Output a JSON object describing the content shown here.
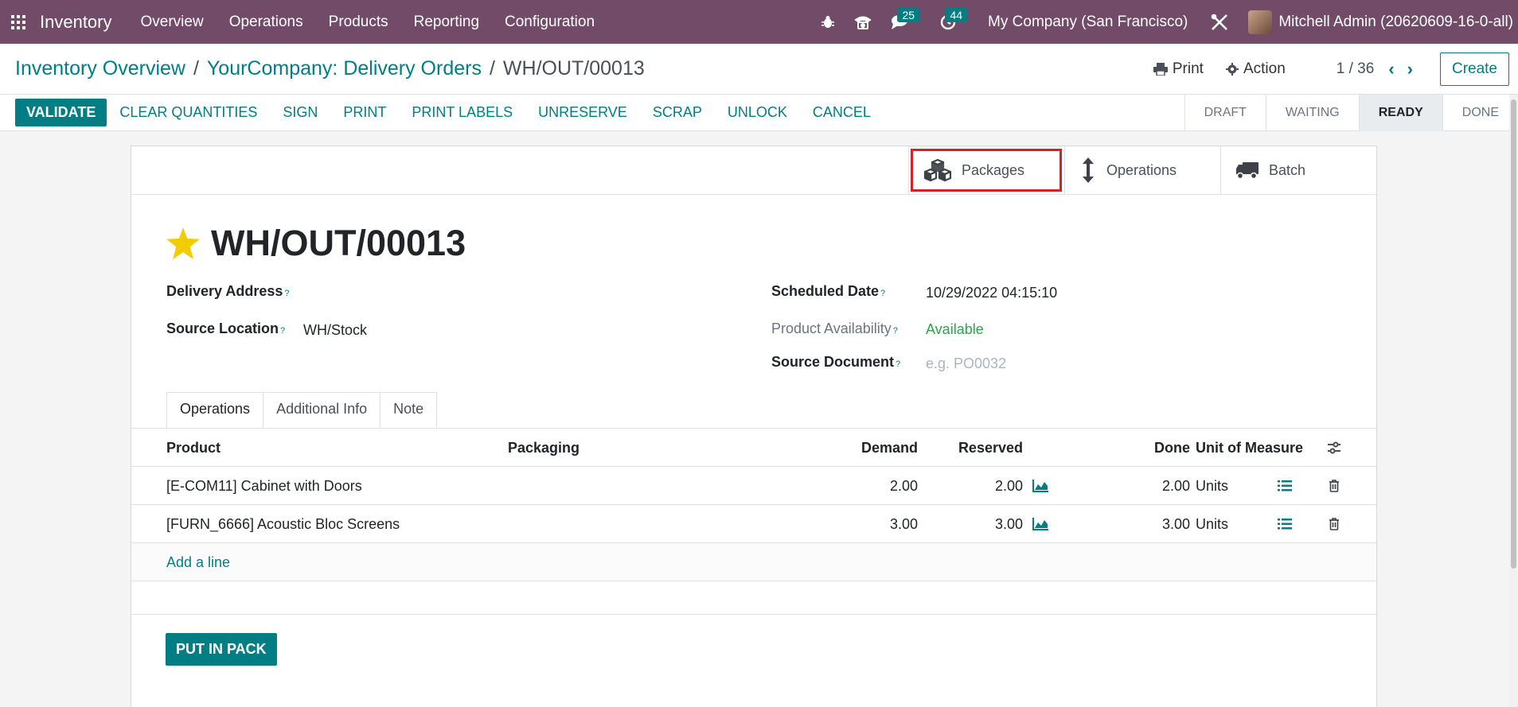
{
  "navbar": {
    "app_name": "Inventory",
    "menu": [
      "Overview",
      "Operations",
      "Products",
      "Reporting",
      "Configuration"
    ],
    "chat_badge": "25",
    "activity_badge": "44",
    "company": "My Company (San Francisco)",
    "user": "Mitchell Admin (20620609-16-0-all)"
  },
  "breadcrumb": {
    "items": [
      "Inventory Overview",
      "YourCompany: Delivery Orders"
    ],
    "current": "WH/OUT/00013"
  },
  "control": {
    "print_label": "Print",
    "action_label": "Action",
    "pager": "1 / 36",
    "create_label": "Create"
  },
  "statusbar": {
    "buttons": [
      "VALIDATE",
      "CLEAR QUANTITIES",
      "SIGN",
      "PRINT",
      "PRINT LABELS",
      "UNRESERVE",
      "SCRAP",
      "UNLOCK",
      "CANCEL"
    ],
    "stages": [
      "DRAFT",
      "WAITING",
      "READY",
      "DONE"
    ],
    "active_stage": "READY"
  },
  "smart_buttons": {
    "packages": "Packages",
    "operations": "Operations",
    "batch": "Batch"
  },
  "record": {
    "title": "WH/OUT/00013",
    "delivery_address_label": "Delivery Address",
    "delivery_address": "",
    "source_location_label": "Source Location",
    "source_location": "WH/Stock",
    "scheduled_date_label": "Scheduled Date",
    "scheduled_date": "10/29/2022 04:15:10",
    "availability_label": "Product Availability",
    "availability": "Available",
    "source_document_label": "Source Document",
    "source_document_placeholder": "e.g. PO0032",
    "help_mark": "?"
  },
  "tabs": [
    "Operations",
    "Additional Info",
    "Note"
  ],
  "table": {
    "headers": {
      "product": "Product",
      "packaging": "Packaging",
      "demand": "Demand",
      "reserved": "Reserved",
      "done": "Done",
      "uom": "Unit of Measure"
    },
    "rows": [
      {
        "product": "[E-COM11] Cabinet with Doors",
        "packaging": "",
        "demand": "2.00",
        "reserved": "2.00",
        "done": "2.00",
        "uom": "Units"
      },
      {
        "product": "[FURN_6666] Acoustic Bloc Screens",
        "packaging": "",
        "demand": "3.00",
        "reserved": "3.00",
        "done": "3.00",
        "uom": "Units"
      }
    ],
    "add_line": "Add a line"
  },
  "put_in_pack": "PUT IN PACK",
  "colors": {
    "navbar": "#714B67",
    "primary": "#017e84",
    "highlight_box": "#d62128",
    "available": "#28a745"
  }
}
